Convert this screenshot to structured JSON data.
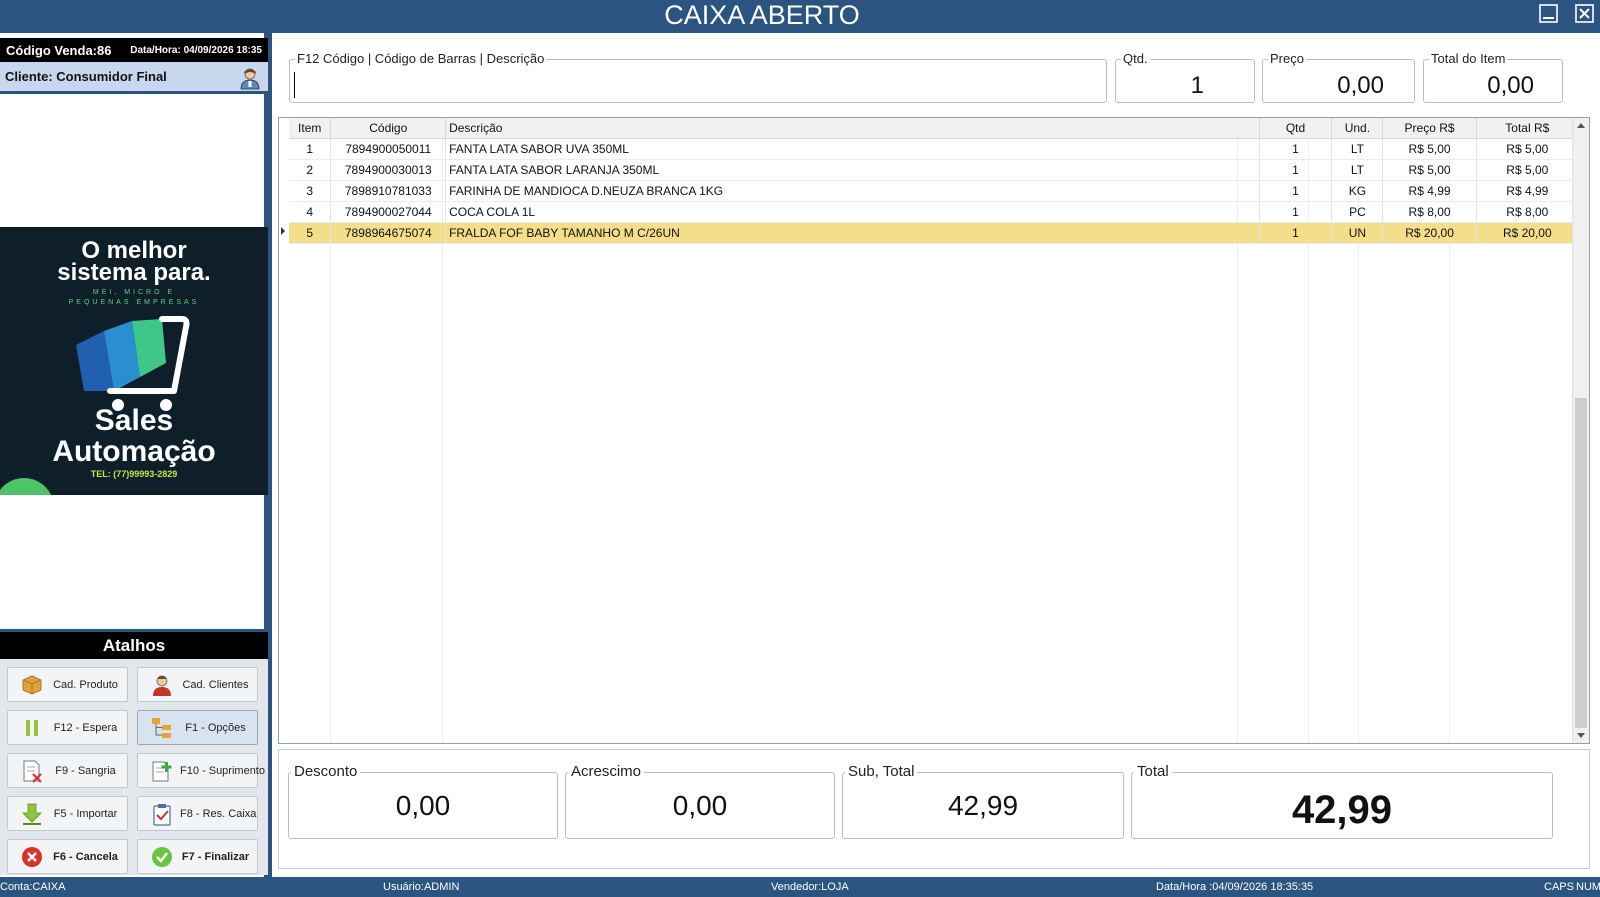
{
  "window": {
    "title": "CAIXA ABERTO"
  },
  "sale": {
    "code_label": "Código Venda:86",
    "datetime": "Data/Hora: 04/09/2026 18:35"
  },
  "client": {
    "label": "Cliente: Consumidor Final"
  },
  "promo": {
    "headline_1": "O melhor",
    "headline_2": "sistema para.",
    "tagline_1": "MEI, MICRO E",
    "tagline_2": "PEQUENAS EMPRESAS",
    "brand_1": "Sales",
    "brand_2": "Automação",
    "phone": "TEL: (77)99993-2829"
  },
  "shortcuts": {
    "title": "Atalhos",
    "buttons": [
      {
        "label": "Cad. Produto",
        "icon": "box-icon"
      },
      {
        "label": "Cad. Clientes",
        "icon": "user-icon"
      },
      {
        "label": "F12 - Espera",
        "icon": "pause-icon"
      },
      {
        "label": "F1 - Opções",
        "icon": "options-tree-icon"
      },
      {
        "label": "F9 - Sangria",
        "icon": "document-remove-icon"
      },
      {
        "label": "F10 - Suprimento",
        "icon": "document-add-icon"
      },
      {
        "label": "F5 - Importar",
        "icon": "download-arrow-icon"
      },
      {
        "label": "F8 - Res. Caixa",
        "icon": "clipboard-check-icon"
      },
      {
        "label": "F6 - Cancela",
        "icon": "cancel-circle-icon"
      },
      {
        "label": "F7 - Finalizar",
        "icon": "check-circle-icon"
      }
    ]
  },
  "entry": {
    "search_label": "F12  Código | Código de Barras | Descrição",
    "search_value": "",
    "qty_label": "Qtd.",
    "qty_value": "1",
    "price_label": "Preço",
    "price_value": "0,00",
    "item_total_label": "Total do Item",
    "item_total_value": "0,00"
  },
  "grid": {
    "columns": [
      "Item",
      "Código",
      "Descrição",
      "Qtd",
      "Und.",
      "Preço R$",
      "Total R$"
    ],
    "rows": [
      [
        "1",
        "7894900050011",
        "FANTA LATA SABOR UVA 350ML",
        "1",
        "LT",
        "R$ 5,00",
        "R$ 5,00"
      ],
      [
        "2",
        "7894900030013",
        "FANTA LATA SABOR LARANJA 350ML",
        "1",
        "LT",
        "R$ 5,00",
        "R$ 5,00"
      ],
      [
        "3",
        "7898910781033",
        "FARINHA DE MANDIOCA D.NEUZA BRANCA 1KG",
        "1",
        "KG",
        "R$ 4,99",
        "R$ 4,99"
      ],
      [
        "4",
        "7894900027044",
        "COCA COLA 1L",
        "1",
        "PC",
        "R$ 8,00",
        "R$ 8,00"
      ],
      [
        "5",
        "7898964675074",
        "FRALDA FOF BABY TAMANHO M C/26UN",
        "1",
        "UN",
        "R$ 20,00",
        "R$ 20,00"
      ]
    ],
    "selected_row": 5
  },
  "totals": {
    "discount_label": "Desconto",
    "discount_value": "0,00",
    "surcharge_label": "Acrescimo",
    "surcharge_value": "0,00",
    "subtotal_label": "Sub, Total",
    "subtotal_value": "42,99",
    "total_label": "Total",
    "total_value": "42,99"
  },
  "status": {
    "account": "Conta:CAIXA",
    "user": "Usuário:ADMIN",
    "seller": "Vendedor:LOJA",
    "datetime": "Data/Hora :04/09/2026 18:35:35",
    "caps": "CAPS",
    "num": "NUM"
  },
  "colors": {
    "frame": "#2b5480",
    "selected_row": "#f5de8a",
    "client_bar": "#c7d8ee"
  }
}
